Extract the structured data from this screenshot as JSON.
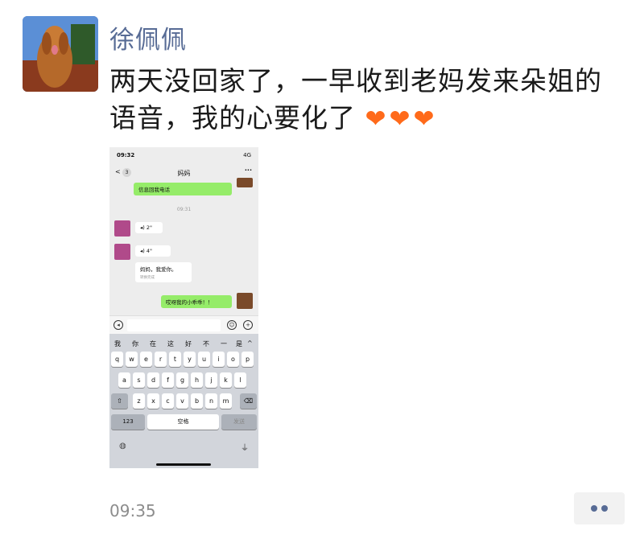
{
  "post": {
    "author": "徐佩佩",
    "text": "两天没回家了，一早收到老妈发来朵姐的语音，我的心要化了",
    "hearts": "❤❤❤",
    "time": "09:35"
  },
  "screenshot": {
    "status_time": "09:32",
    "status_signal": "4G",
    "nav_back": "<",
    "nav_badge": "3",
    "nav_title": "妈妈",
    "nav_more": "···",
    "msg_top": "信息回我电话",
    "chat_time": "09:31",
    "voice1": "2\"",
    "voice2": "4\"",
    "text_msg": "妈妈，我爱你。",
    "text_sub": "转换完成",
    "reply": "哎呀我的小乖乖！！",
    "candidates": [
      "我",
      "你",
      "在",
      "这",
      "好",
      "不",
      "一",
      "是"
    ],
    "row1": [
      "q",
      "w",
      "e",
      "r",
      "t",
      "y",
      "u",
      "i",
      "o",
      "p"
    ],
    "row2": [
      "a",
      "s",
      "d",
      "f",
      "g",
      "h",
      "j",
      "k",
      "l"
    ],
    "row3": [
      "z",
      "x",
      "c",
      "v",
      "b",
      "n",
      "m"
    ],
    "key_123": "123",
    "key_space": "空格",
    "key_send": "发送"
  },
  "icons": {
    "voice": "speaker-icon",
    "emoji": "emoji-icon",
    "plus": "plus-icon",
    "globe": "globe-icon",
    "mic": "microphone-icon",
    "shift": "shift-icon",
    "delete": "delete-icon"
  },
  "colors": {
    "author": "#576b95",
    "heart": "#ff6a1a",
    "wechat_green": "#95ec69"
  }
}
